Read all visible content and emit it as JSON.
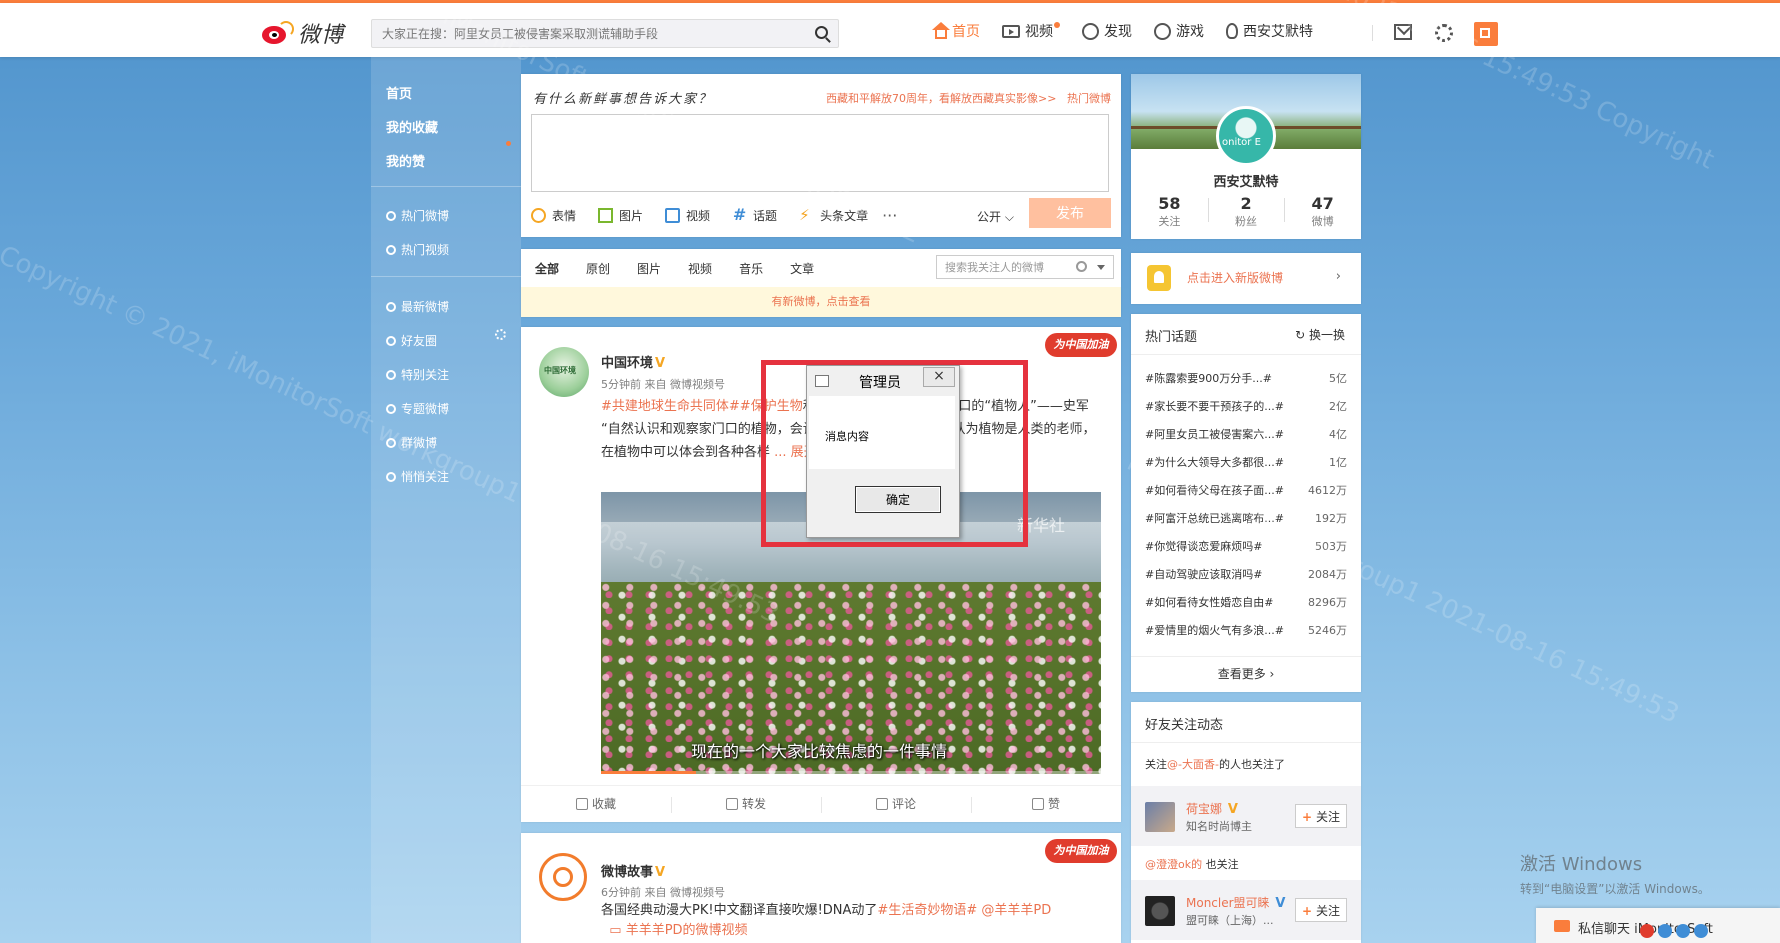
{
  "header": {
    "logo_text": "微博",
    "search_placeholder": "大家正在搜：阿里女员工被侵害案采取测谎辅助手段",
    "nav": [
      {
        "label": "首页"
      },
      {
        "label": "视频"
      },
      {
        "label": "发现"
      },
      {
        "label": "游戏"
      },
      {
        "label": "西安艾默特"
      }
    ]
  },
  "sidebar": {
    "primary": [
      "首页",
      "我的收藏",
      "我的赞"
    ],
    "hot": [
      "热门微博",
      "热门视频"
    ],
    "groups": [
      "最新微博",
      "好友圈",
      "特别关注",
      "专题微博",
      "群微博",
      "悄悄关注"
    ]
  },
  "composer": {
    "prompt": "有什么新鲜事想告诉大家？",
    "promo": "西藏和平解放70周年，看解放西藏真实影像>>",
    "hot_link": "热门微博",
    "tools": [
      "表情",
      "图片",
      "视频",
      "话题",
      "头条文章"
    ],
    "more": "···",
    "visibility": "公开",
    "submit": "发布"
  },
  "feed_filter": {
    "tabs": [
      "全部",
      "原创",
      "图片",
      "视频",
      "音乐",
      "文章"
    ],
    "search_placeholder": "搜索我关注人的微博",
    "notice": "有新微博，点击查看"
  },
  "posts": [
    {
      "author": "中国环境",
      "avatar_text": "中国环境",
      "meta": "5分钟前 来自 微博视频号",
      "tag1": "#共建地球生命共同体#",
      "tag2": "#保护生物",
      "text_a": "和生物多样性的故事 | 家门口的“植物人”——史军 “自然",
      "text_b": "认识和观察家门口的植物，会让你的生活更加有温度”。",
      "text_c": "认为植物是人类的老师，在植物中可以体会到各种各样",
      "expand": "... 展开全文 ∨",
      "ribbon": "为中国加油",
      "video_watermark": "新华社",
      "video_subtitle": "现在的一个大家比较焦虑的一件事情",
      "video_progress": 0.19,
      "actions": [
        "收藏",
        "转发",
        "评论",
        "赞"
      ]
    },
    {
      "author": "微博故事",
      "meta": "6分钟前 来自 微博视频号",
      "text": "各国经典动漫大PK!中文翻译直接吹爆!DNA动了",
      "tag": "#生活奇妙物语#",
      "mention": "@羊羊羊PD",
      "video_link": "羊羊羊PD的微博视频",
      "ribbon": "为中国加油"
    }
  ],
  "profile": {
    "avatar_text": "onitor E",
    "name": "西安艾默特",
    "stats": [
      {
        "num": "58",
        "label": "关注"
      },
      {
        "num": "2",
        "label": "粉丝"
      },
      {
        "num": "47",
        "label": "微博"
      }
    ]
  },
  "new_version": {
    "text": "点击进入新版微博",
    "arrow": "›"
  },
  "hot_topics": {
    "title": "热门话题",
    "refresh": "换一换",
    "items": [
      {
        "t": "#陈露索要900万分手...#",
        "c": "5亿"
      },
      {
        "t": "#家长要不要干预孩子的...#",
        "c": "2亿"
      },
      {
        "t": "#阿里女员工被侵害案六...#",
        "c": "4亿"
      },
      {
        "t": "#为什么大领导大多都很...#",
        "c": "1亿"
      },
      {
        "t": "#如何看待父母在孩子面...#",
        "c": "4612万"
      },
      {
        "t": "#阿富汗总统已逃离喀布...#",
        "c": "192万"
      },
      {
        "t": "#你觉得谈恋爱麻烦吗#",
        "c": "503万"
      },
      {
        "t": "#自动驾驶应该取消吗#",
        "c": "2084万"
      },
      {
        "t": "#如何看待女性婚恋自由#",
        "c": "8296万"
      },
      {
        "t": "#爱情里的烟火气有多浪...#",
        "c": "5246万"
      }
    ],
    "more": "查看更多 ›"
  },
  "friends": {
    "title": "好友关注动态",
    "line1_a": "关注",
    "line1_link": "@-大面香-",
    "line1_b": "的人也关注了",
    "rec1": {
      "name": "荷宝娜",
      "desc": "知名时尚博主",
      "btn": "关注"
    },
    "line2_link": "@澄澄ok的",
    "line2_b": " 也关注",
    "rec2": {
      "name": "Moncler盟可睐",
      "desc": "盟可睐（上海）...",
      "btn": "关注"
    }
  },
  "dialog": {
    "title": "管理员",
    "close": "×",
    "message": "消息内容",
    "ok": "确定"
  },
  "watermarks": [
    "iMonitorSoft workgroup1 CONFIDENTIAL",
    "Copyright © 2021, iMonitorSoft workgroup1 2021-08-16 15:49:53",
    "Copyright © 2021, iMonitorSoft workgroup1 2021-08-16 15:49:53",
    "2021-08-16 15:49:53 Copyright"
  ],
  "os": {
    "activate_title": "激活 Windows",
    "activate_sub": "转到“电脑设置”以激活 Windows。",
    "msgbar": "私信聊天  iMonitorSoft"
  }
}
